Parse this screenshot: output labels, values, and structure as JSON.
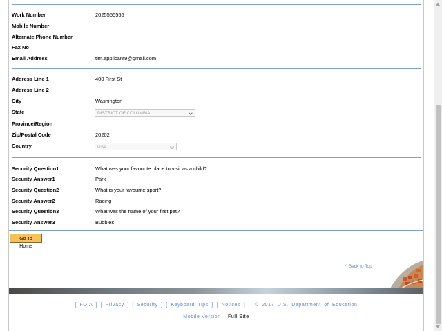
{
  "contact": [
    {
      "label": "Work Number",
      "value": "2025555555"
    },
    {
      "label": "Mobile Number",
      "value": ""
    },
    {
      "label": "Alternate Phone Number",
      "value": ""
    },
    {
      "label": "Fax No",
      "value": ""
    },
    {
      "label": "Email Address",
      "value": "tim.applicant9@gmail.com"
    }
  ],
  "address": {
    "line1": {
      "label": "Address Line 1",
      "value": "400 First St"
    },
    "line2": {
      "label": "Address Line 2",
      "value": ""
    },
    "city": {
      "label": "City",
      "value": "Washington"
    },
    "state": {
      "label": "State",
      "value": "DISTRICT OF COLUMBIA"
    },
    "province": {
      "label": "Province/Region",
      "value": ""
    },
    "zip": {
      "label": "Zip/Postal Code",
      "value": "20202"
    },
    "country": {
      "label": "Country",
      "value": "USA"
    }
  },
  "security": [
    {
      "label": "Security Question1",
      "value": "What was your favourite place to visit as a child?"
    },
    {
      "label": "Security Answer1",
      "value": "Park"
    },
    {
      "label": "Security Question2",
      "value": "What is your favourite sport?"
    },
    {
      "label": "Security Answer2",
      "value": "Racing"
    },
    {
      "label": "Security Question3",
      "value": "What was the name of your first pet?"
    },
    {
      "label": "Security Answer3",
      "value": "Bubbles"
    }
  ],
  "actions": {
    "home_label": "Go To Home"
  },
  "back_to_top": "^ Back to Top",
  "footer": {
    "foia": "[ FOIA ]",
    "privacy": "[ Privacy ]",
    "security": "[ Security ]",
    "keyboard": "[ Keyboard Tips ]",
    "notices": "[ Notices ]",
    "copyright": "© 2017 U.S. Department of Education",
    "mobile": "Mobile Version",
    "separator": "|",
    "full": "Full Site"
  },
  "colors": {
    "rule": "#7fa1c7",
    "link": "#5b8fc7",
    "button": "#f6c15b"
  }
}
